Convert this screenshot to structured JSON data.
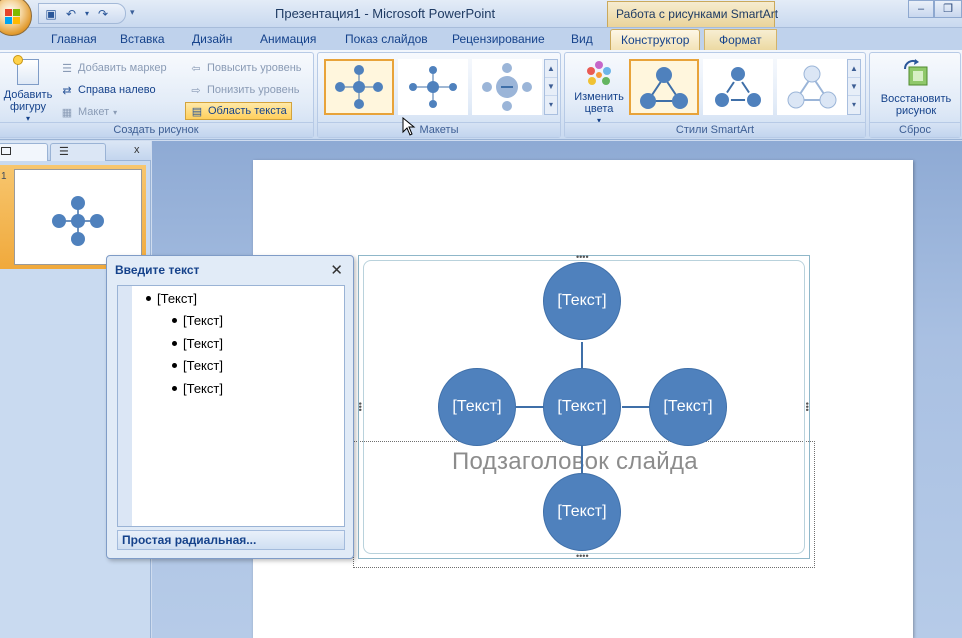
{
  "window": {
    "title": "Презентация1 - Microsoft PowerPoint",
    "context_tab_title": "Работа с рисунками SmartArt"
  },
  "tabs": [
    "Главная",
    "Вставка",
    "Дизайн",
    "Анимация",
    "Показ слайдов",
    "Рецензирование",
    "Вид",
    "Конструктор",
    "Формат"
  ],
  "active_tab": "Конструктор",
  "ribbon": {
    "create_group": {
      "label": "Создать рисунок",
      "add_shape": "Добавить фигуру",
      "add_bullet": "Добавить маркер",
      "right_to_left": "Справа налево",
      "layout": "Макет",
      "promote": "Повысить уровень",
      "demote": "Понизить уровень",
      "text_pane": "Область текста"
    },
    "layouts_group": {
      "label": "Макеты"
    },
    "styles_group": {
      "label": "Стили SmartArt",
      "change_colors": "Изменить цвета"
    },
    "reset_group": {
      "label": "Сброс",
      "reset_graphic": "Восстановить рисунок"
    }
  },
  "text_pane": {
    "title": "Введите текст",
    "items": [
      {
        "text": "[Текст]",
        "level": 1
      },
      {
        "text": "[Текст]",
        "level": 2
      },
      {
        "text": "[Текст]",
        "level": 2
      },
      {
        "text": "[Текст]",
        "level": 2
      },
      {
        "text": "[Текст]",
        "level": 2
      }
    ],
    "footer": "Простая радиальная..."
  },
  "slide": {
    "number": "1",
    "subtitle": "Подзаголовок слайда",
    "nodes": {
      "top": "[Текст]",
      "left": "[Текст]",
      "center": "[Текст]",
      "right": "[Текст]",
      "bottom": "[Текст]"
    }
  },
  "colors": {
    "node_fill": "#4f81bd",
    "accent_orange": "#e8a33a",
    "ribbon_text": "#15428b"
  }
}
